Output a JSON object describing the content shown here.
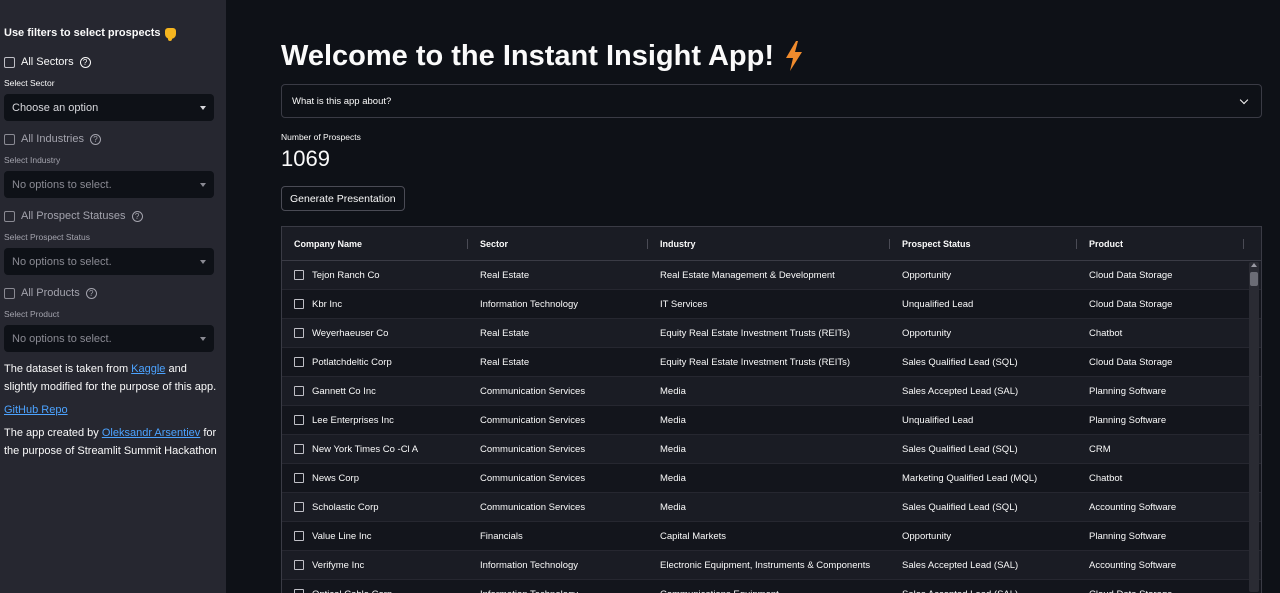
{
  "sidebar": {
    "title": "Use filters to select prospects",
    "all_sectors": "All Sectors",
    "select_sector_label": "Select Sector",
    "select_sector_value": "Choose an option",
    "all_industries": "All Industries",
    "select_industry_label": "Select Industry",
    "select_industry_value": "No options to select.",
    "all_statuses": "All Prospect Statuses",
    "select_status_label": "Select Prospect Status",
    "select_status_value": "No options to select.",
    "all_products": "All Products",
    "select_product_label": "Select Product",
    "select_product_value": "No options to select.",
    "dataset_prefix": "The dataset is taken from ",
    "dataset_link": "Kaggle",
    "dataset_suffix": " and slightly modified for the purpose of this app.",
    "github_link": "GitHub Repo",
    "created_prefix": "The app created by ",
    "created_link": "Oleksandr Arsentiev",
    "created_suffix": " for the purpose of Streamlit Summit Hackathon"
  },
  "main": {
    "title": "Welcome to the Instant Insight App!",
    "expander_label": "What is this app about?",
    "metric_label": "Number of Prospects",
    "metric_value": "1069",
    "generate_button": "Generate Presentation"
  },
  "table": {
    "headers": [
      "Company Name",
      "Sector",
      "Industry",
      "Prospect Status",
      "Product"
    ],
    "rows": [
      [
        "Tejon Ranch Co",
        "Real Estate",
        "Real Estate Management & Development",
        "Opportunity",
        "Cloud Data Storage"
      ],
      [
        "Kbr Inc",
        "Information Technology",
        "IT Services",
        "Unqualified Lead",
        "Cloud Data Storage"
      ],
      [
        "Weyerhaeuser Co",
        "Real Estate",
        "Equity Real Estate Investment Trusts (REITs)",
        "Opportunity",
        "Chatbot"
      ],
      [
        "Potlatchdeltic Corp",
        "Real Estate",
        "Equity Real Estate Investment Trusts (REITs)",
        "Sales Qualified Lead (SQL)",
        "Cloud Data Storage"
      ],
      [
        "Gannett Co Inc",
        "Communication Services",
        "Media",
        "Sales Accepted Lead (SAL)",
        "Planning Software"
      ],
      [
        "Lee Enterprises Inc",
        "Communication Services",
        "Media",
        "Unqualified Lead",
        "Planning Software"
      ],
      [
        "New York Times Co -Cl A",
        "Communication Services",
        "Media",
        "Sales Qualified Lead (SQL)",
        "CRM"
      ],
      [
        "News Corp",
        "Communication Services",
        "Media",
        "Marketing Qualified Lead (MQL)",
        "Chatbot"
      ],
      [
        "Scholastic Corp",
        "Communication Services",
        "Media",
        "Sales Qualified Lead (SQL)",
        "Accounting Software"
      ],
      [
        "Value Line Inc",
        "Financials",
        "Capital Markets",
        "Opportunity",
        "Planning Software"
      ],
      [
        "Verifyme Inc",
        "Information Technology",
        "Electronic Equipment, Instruments & Components",
        "Sales Accepted Lead (SAL)",
        "Accounting Software"
      ],
      [
        "Optical Cable Corp",
        "Information Technology",
        "Communications Equipment",
        "Sales Accepted Lead (SAL)",
        "Cloud Data Storage"
      ]
    ]
  },
  "colors": {
    "background": "#0e1117",
    "sidebar": "#262730",
    "link": "#4ca3ff",
    "accent": "#f08b2d"
  }
}
